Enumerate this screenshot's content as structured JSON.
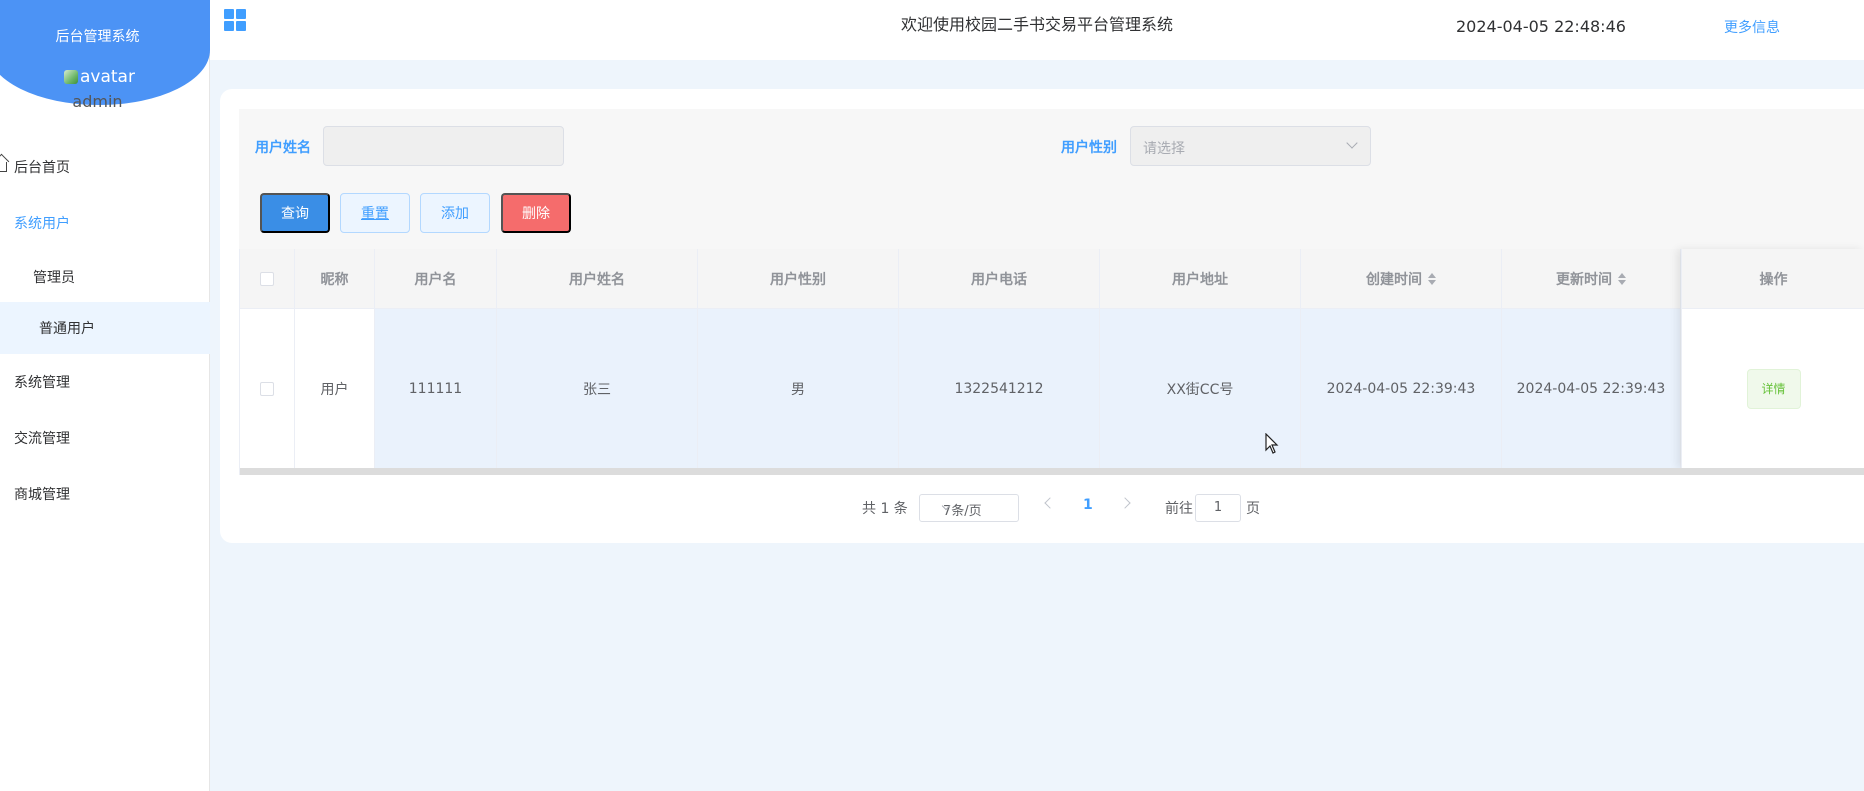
{
  "sidebar": {
    "title": "后台管理系统",
    "avatar_alt": "avatar",
    "username": "admin",
    "items": [
      {
        "label": "后台首页"
      },
      {
        "label": "系统用户"
      },
      {
        "label": "管理员"
      },
      {
        "label": "普通用户"
      },
      {
        "label": "系统管理"
      },
      {
        "label": "交流管理"
      },
      {
        "label": "商城管理"
      }
    ]
  },
  "header": {
    "welcome": "欢迎使用校园二手书交易平台管理系统",
    "datetime": "2024-04-05 22:48:46",
    "more": "更多信息"
  },
  "search": {
    "name_label": "用户姓名",
    "name_value": "",
    "gender_label": "用户性别",
    "gender_placeholder": "请选择",
    "buttons": {
      "query": "查询",
      "reset": "重置",
      "add": "添加",
      "delete": "删除"
    }
  },
  "table": {
    "columns": [
      "昵称",
      "用户名",
      "用户姓名",
      "用户性别",
      "用户电话",
      "用户地址",
      "创建时间",
      "更新时间",
      "操作"
    ],
    "rows": [
      {
        "nickname": "用户",
        "username": "111111",
        "realname": "张三",
        "gender": "男",
        "phone": "1322541212",
        "address": "XX街CC号",
        "created": "2024-04-05 22:39:43",
        "updated": "2024-04-05 22:39:43",
        "action": "详情"
      }
    ]
  },
  "pagination": {
    "total": "共 1 条",
    "page_size": "7条/页",
    "current_page": "1",
    "goto_label": "前往",
    "goto_value": "1",
    "page_suffix": "页"
  },
  "colors": {
    "accent": "#409eff",
    "sidebar_head": "#4c93f5",
    "danger": "#f56c6c",
    "success": "#67c23a"
  }
}
